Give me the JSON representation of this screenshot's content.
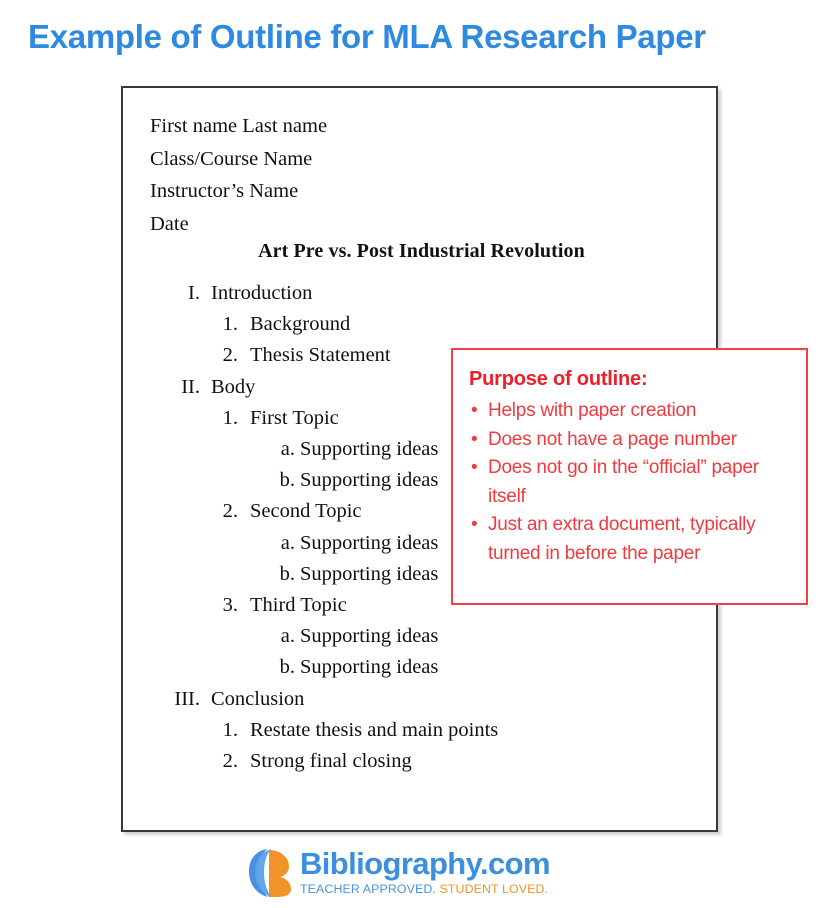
{
  "page": {
    "title": "Example of Outline for MLA Research Paper",
    "title_color": "#2d8ae0"
  },
  "document": {
    "header_lines": [
      "First name Last name",
      "Class/Course Name",
      "Instructor’s Name",
      "Date"
    ],
    "paper_heading": "Art Pre vs. Post Industrial Revolution",
    "outline": [
      {
        "level": 1,
        "marker": "I.",
        "text": "Introduction"
      },
      {
        "level": 2,
        "marker": "1.",
        "text": "Background"
      },
      {
        "level": 2,
        "marker": "2.",
        "text": "Thesis Statement"
      },
      {
        "level": 1,
        "marker": "II.",
        "text": "Body"
      },
      {
        "level": 2,
        "marker": "1.",
        "text": "First Topic"
      },
      {
        "level": 3,
        "marker": "a.",
        "text": "Supporting ideas"
      },
      {
        "level": 3,
        "marker": "b.",
        "text": "Supporting ideas"
      },
      {
        "level": 2,
        "marker": "2.",
        "text": "Second Topic"
      },
      {
        "level": 3,
        "marker": "a.",
        "text": "Supporting ideas"
      },
      {
        "level": 3,
        "marker": "b.",
        "text": "Supporting ideas"
      },
      {
        "level": 2,
        "marker": "3.",
        "text": "Third Topic"
      },
      {
        "level": 3,
        "marker": "a.",
        "text": "Supporting ideas"
      },
      {
        "level": 3,
        "marker": "b.",
        "text": "Supporting ideas"
      },
      {
        "level": 1,
        "marker": "III.",
        "text": "Conclusion"
      },
      {
        "level": 2,
        "marker": "1.",
        "text": "Restate thesis and main points"
      },
      {
        "level": 2,
        "marker": "2.",
        "text": "Strong final closing"
      }
    ]
  },
  "callout": {
    "title": "Purpose of outline:",
    "border_color": "#f2404a",
    "text_color": "#f13a3f",
    "items": [
      "Helps with paper creation",
      "Does not have a page number",
      "Does not go in the “official” paper itself",
      "Just an extra document, typically turned in before the paper"
    ]
  },
  "footer": {
    "wordmark": "Bibliography.com",
    "tagline_blue": "TEACHER APPROVED.",
    "tagline_orange": "STUDENT LOVED.",
    "logo_blue": "#3a8fe0",
    "logo_orange": "#f2932a"
  }
}
